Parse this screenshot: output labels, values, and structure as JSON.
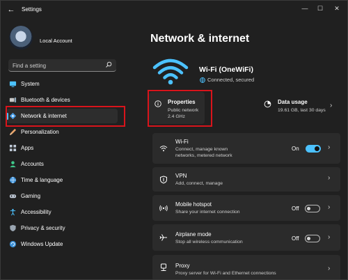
{
  "window": {
    "title": "Settings"
  },
  "account": {
    "name": "Local Account"
  },
  "search": {
    "placeholder": "Find a setting"
  },
  "sidebar": {
    "items": [
      {
        "label": "System",
        "icon": "system-icon"
      },
      {
        "label": "Bluetooth & devices",
        "icon": "bluetooth-icon"
      },
      {
        "label": "Network & internet",
        "icon": "network-icon",
        "active": true
      },
      {
        "label": "Personalization",
        "icon": "brush-icon"
      },
      {
        "label": "Apps",
        "icon": "apps-icon"
      },
      {
        "label": "Accounts",
        "icon": "person-icon"
      },
      {
        "label": "Time & language",
        "icon": "globe-icon"
      },
      {
        "label": "Gaming",
        "icon": "gamepad-icon"
      },
      {
        "label": "Accessibility",
        "icon": "accessibility-icon"
      },
      {
        "label": "Privacy & security",
        "icon": "shield-icon"
      },
      {
        "label": "Windows Update",
        "icon": "update-icon"
      }
    ]
  },
  "main": {
    "title": "Network & internet",
    "network": {
      "name": "Wi-Fi (OneWiFi)",
      "status": "Connected, secured"
    },
    "properties": {
      "title": "Properties",
      "line1": "Public network",
      "line2": "2.4 GHz"
    },
    "data_usage": {
      "title": "Data usage",
      "detail": "19.61 GB, last 30 days"
    },
    "rows": [
      {
        "title": "Wi-Fi",
        "desc": "Connect, manage known networks, metered network",
        "toggle": "On"
      },
      {
        "title": "VPN",
        "desc": "Add, connect, manage"
      },
      {
        "title": "Mobile hotspot",
        "desc": "Share your internet connection",
        "toggle": "Off"
      },
      {
        "title": "Airplane mode",
        "desc": "Stop all wireless communication",
        "toggle": "Off"
      },
      {
        "title": "Proxy",
        "desc": "Proxy server for Wi-Fi and Ethernet connections"
      }
    ]
  },
  "colors": {
    "accent": "#4cc2ff",
    "highlight": "#d9141b",
    "background": "#202020",
    "card": "#2b2b2b"
  }
}
